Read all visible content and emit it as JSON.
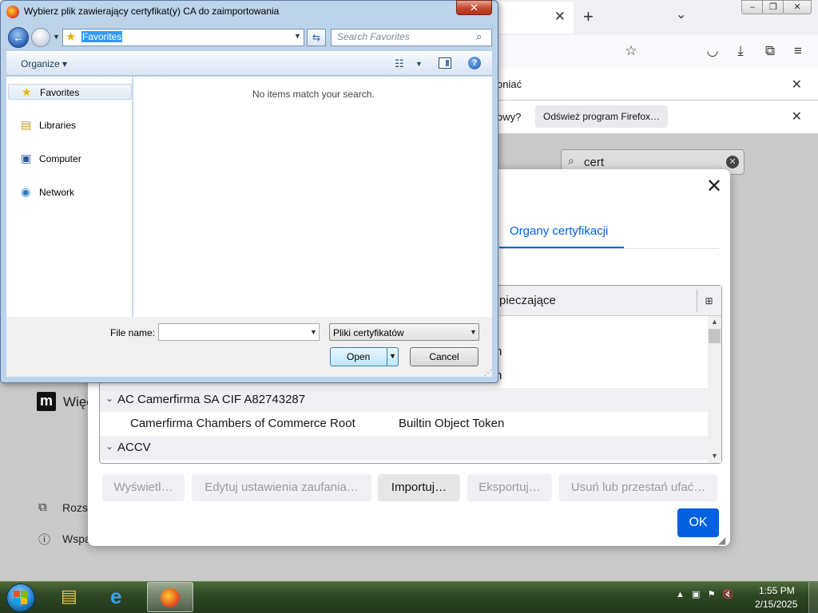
{
  "firefox": {
    "notification1_text": "oniać",
    "notification2_text": "owy?",
    "refresh_button": "Odśwież program Firefox…",
    "search_value": "cert",
    "sidebar": {
      "more_label": "Więc",
      "support_label": "Rozsz",
      "help_label": "Wspa"
    }
  },
  "cert_manager": {
    "tab_label": "Organy certyfikacji",
    "column_header": "pieczające",
    "rows": [
      {
        "type": "child",
        "name": "",
        "token": "n"
      },
      {
        "type": "child",
        "name": "",
        "token": "n"
      },
      {
        "type": "group",
        "name": "AC Camerfirma SA CIF A82743287"
      },
      {
        "type": "child",
        "name": "Camerfirma Chambers of Commerce Root",
        "token": "Builtin Object Token"
      },
      {
        "type": "group",
        "name": "ACCV"
      }
    ],
    "buttons": {
      "view": "Wyświetl…",
      "edit_trust": "Edytuj ustawienia zaufania…",
      "import": "Importuj…",
      "export": "Eksportuj…",
      "delete": "Usuń lub przestań ufać…",
      "ok": "OK"
    }
  },
  "file_dialog": {
    "title": "Wybierz plik zawierający certyfikat(y) CA do zaimportowania",
    "address": "Favorites",
    "search_placeholder": "Search Favorites",
    "organize": "Organize",
    "empty_message": "No items match your search.",
    "nav_items": [
      {
        "label": "Favorites",
        "icon": "star-icon"
      },
      {
        "label": "Libraries",
        "icon": "libraries-icon"
      },
      {
        "label": "Computer",
        "icon": "computer-icon"
      },
      {
        "label": "Network",
        "icon": "network-icon"
      }
    ],
    "file_name_label": "File name:",
    "file_name_value": "",
    "filter": "Pliki certyfikatów",
    "open_button": "Open",
    "cancel_button": "Cancel"
  },
  "taskbar": {
    "time": "1:55 PM",
    "date": "2/15/2025",
    "apps": [
      "explorer-icon",
      "ie-icon",
      "firefox-icon"
    ]
  }
}
